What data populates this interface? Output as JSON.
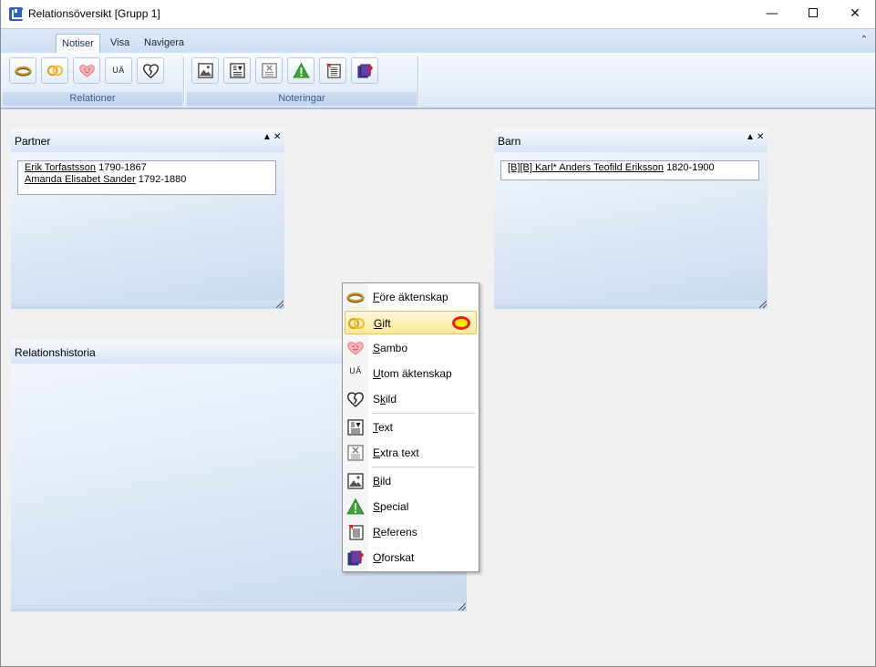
{
  "window": {
    "title": "Relationsöversikt [Grupp 1]",
    "minimize_glyph": "—",
    "close_glyph": "✕"
  },
  "ribbon": {
    "tabs": [
      {
        "label": "Notiser",
        "active": true
      },
      {
        "label": "Visa",
        "active": false
      },
      {
        "label": "Navigera",
        "active": false
      }
    ],
    "collapse_glyph": "⌃",
    "groups": {
      "relationer": {
        "label": "Relationer",
        "buttons": [
          "ring-icon",
          "wedding-rings-icon",
          "heart-face-icon",
          "uae-text-icon",
          "broken-heart-icon"
        ],
        "uae_text": "UÄ"
      },
      "noteringar": {
        "label": "Noteringar",
        "buttons": [
          "image-icon",
          "text-note-icon",
          "extra-text-icon",
          "warning-icon",
          "reference-icon",
          "unresearched-icon"
        ]
      }
    }
  },
  "panels": {
    "partner": {
      "title": "Partner",
      "rows": [
        {
          "name": "Erik Torfastsson",
          "years": "1790-1867"
        },
        {
          "name": "Amanda Elisabet Sander",
          "years": "1792-1880"
        }
      ]
    },
    "barn": {
      "title": "Barn",
      "rows": [
        {
          "name": "[B][B] Karl* Anders Teofild Eriksson",
          "years": "1820-1900"
        }
      ]
    },
    "historia": {
      "title": "Relationshistoria"
    },
    "up_glyph": "▲",
    "close_glyph": "✕"
  },
  "context_menu": {
    "items": [
      {
        "mnemonic": "F",
        "rest": "öre äktenskap",
        "icon": "ring-icon"
      },
      {
        "mnemonic": "G",
        "rest": "ift",
        "icon": "wedding-rings-icon",
        "highlighted": true
      },
      {
        "mnemonic": "S",
        "rest": "ambo",
        "icon": "heart-face-icon"
      },
      {
        "mnemonic": "U",
        "rest": "tom äktenskap",
        "icon": "uae-text-icon",
        "icon_text": "UÄ"
      },
      {
        "pre": "S",
        "mnemonic": "k",
        "rest": "ild",
        "icon": "broken-heart-icon"
      },
      {
        "mnemonic": "T",
        "rest": "ext",
        "icon": "text-note-icon"
      },
      {
        "mnemonic": "E",
        "rest": "xtra text",
        "icon": "extra-text-icon"
      },
      {
        "mnemonic": "B",
        "rest": "ild",
        "icon": "image-icon"
      },
      {
        "mnemonic": "S",
        "rest": "pecial",
        "icon": "warning-icon"
      },
      {
        "mnemonic": "R",
        "rest": "eferens",
        "icon": "reference-icon"
      },
      {
        "mnemonic": "O",
        "rest": "forskat",
        "icon": "unresearched-icon"
      }
    ]
  },
  "colors": {
    "ribbon_group_label": "#3c5b8c",
    "menu_highlight": "#fde89a",
    "warning_green": "#3aa537"
  }
}
